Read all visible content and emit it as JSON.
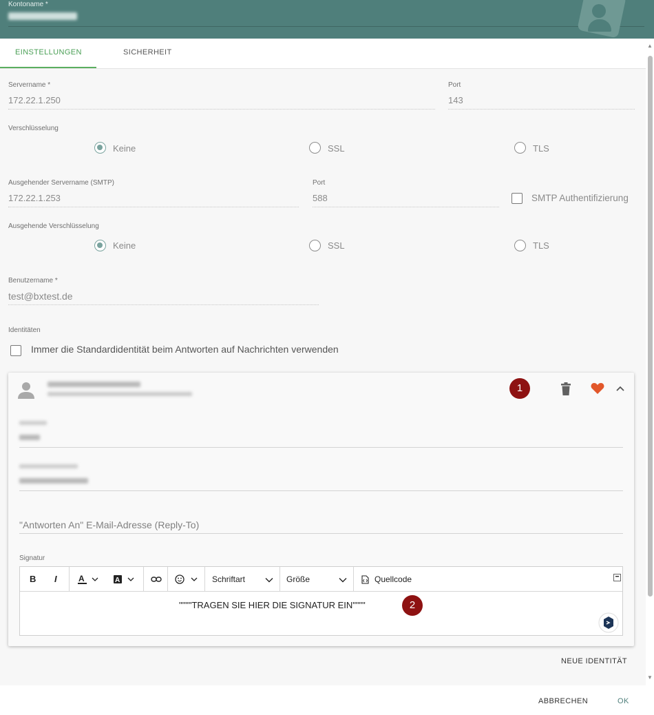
{
  "header": {
    "label": "Kontoname *"
  },
  "tabs": [
    {
      "label": "EINSTELLUNGEN"
    },
    {
      "label": "SICHERHEIT"
    }
  ],
  "incoming": {
    "server_label": "Servername *",
    "server_value": "172.22.1.250",
    "port_label": "Port",
    "port_value": "143",
    "encryption_label": "Verschlüsselung",
    "encryption_options": [
      "Keine",
      "SSL",
      "TLS"
    ],
    "encryption_selected": "Keine"
  },
  "outgoing": {
    "server_label": "Ausgehender Servername (SMTP)",
    "server_value": "172.22.1.253",
    "port_label": "Port",
    "port_value": "588",
    "auth_label": "SMTP Authentifizierung",
    "encryption_label": "Ausgehende Verschlüsselung",
    "encryption_options": [
      "Keine",
      "SSL",
      "TLS"
    ],
    "encryption_selected": "Keine"
  },
  "user": {
    "label": "Benutzername *",
    "value": "test@bxtest.de"
  },
  "identities": {
    "label": "Identitäten",
    "default_identity_checkbox": "Immer die Standardidentität beim Antworten auf Nachrichten verwenden",
    "card": {
      "badge1": "1",
      "badge2": "2",
      "reply_to_placeholder": "\"Antworten An\" E-Mail-Adresse (Reply-To)",
      "signature_label": "Signatur",
      "editor": {
        "bold": "B",
        "italic": "I",
        "font_placeholder": "Schriftart",
        "size_placeholder": "Größe",
        "source_label": "Quellcode",
        "content": "\"\"\"\"TRAGEN SIE HIER DIE SIGNATUR EIN\"\"\"\""
      }
    },
    "new_identity_button": "NEUE IDENTITÄT"
  },
  "footer": {
    "cancel": "ABBRECHEN",
    "ok": "OK"
  },
  "colors": {
    "header": "#4f7f7b",
    "accent_green": "#5aae5f",
    "heart": "#e2572a",
    "badge": "#8e1212"
  }
}
